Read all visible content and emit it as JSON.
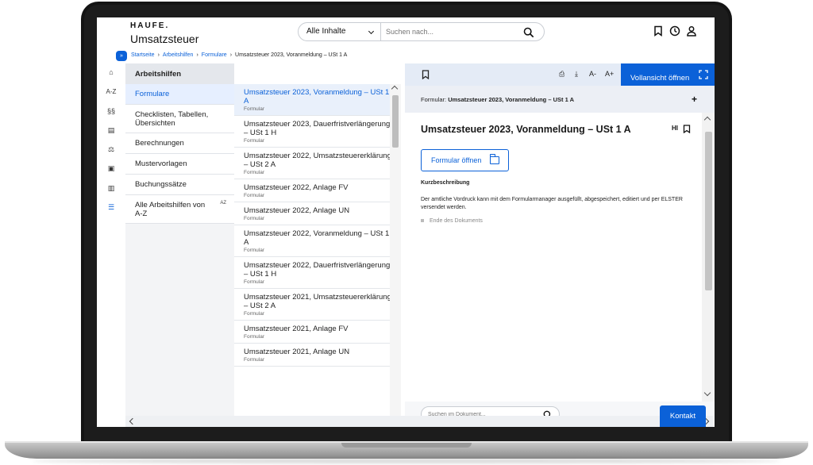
{
  "header": {
    "logo": "HAUFE.",
    "title": "Umsatzsteuer",
    "search_scope": "Alle Inhalte",
    "search_placeholder": "Suchen nach..."
  },
  "breadcrumb": {
    "toggle": "»",
    "items": [
      "Startseite",
      "Arbeitshilfen",
      "Formulare"
    ],
    "current": "Umsatzsteuer 2023, Voranmeldung – USt 1 A",
    "separator": "›"
  },
  "rail": {
    "items": [
      {
        "icon": "home-icon",
        "glyph": "⌂"
      },
      {
        "icon": "a-z-icon",
        "glyph": "A-Z"
      },
      {
        "icon": "paragraph-icon",
        "glyph": "§§"
      },
      {
        "icon": "document-icon",
        "glyph": "▤"
      },
      {
        "icon": "scales-icon",
        "glyph": "⚖"
      },
      {
        "icon": "video-icon",
        "glyph": "▣"
      },
      {
        "icon": "books-icon",
        "glyph": "▥"
      },
      {
        "icon": "list-icon",
        "glyph": "☰"
      }
    ]
  },
  "categories": {
    "heading": "Arbeitshilfen",
    "items": [
      {
        "label": "Formulare"
      },
      {
        "label": "Checklisten, Tabellen, Übersichten"
      },
      {
        "label": "Berechnungen"
      },
      {
        "label": "Mustervorlagen"
      },
      {
        "label": "Buchungssätze"
      },
      {
        "label": "Alle Arbeitshilfen von A-Z",
        "badge": "AZ"
      }
    ]
  },
  "documents": [
    {
      "title": "Umsatzsteuer 2023, Voranmeldung – USt 1 A",
      "type": "Formular"
    },
    {
      "title": "Umsatzsteuer 2023, Dauerfristverlängerung – USt 1 H",
      "type": "Formular"
    },
    {
      "title": "Umsatzsteuer 2022, Umsatzsteuererklärung – USt 2 A",
      "type": "Formular"
    },
    {
      "title": "Umsatzsteuer 2022, Anlage FV",
      "type": "Formular"
    },
    {
      "title": "Umsatzsteuer 2022, Anlage UN",
      "type": "Formular"
    },
    {
      "title": "Umsatzsteuer 2022, Voranmeldung – USt 1 A",
      "type": "Formular"
    },
    {
      "title": "Umsatzsteuer 2022, Dauerfristverlängerung – USt 1 H",
      "type": "Formular"
    },
    {
      "title": "Umsatzsteuer 2021, Umsatzsteuererklärung – USt 2 A",
      "type": "Formular"
    },
    {
      "title": "Umsatzsteuer 2021, Anlage FV",
      "type": "Formular"
    },
    {
      "title": "Umsatzsteuer 2021, Anlage UN",
      "type": "Formular"
    }
  ],
  "detail": {
    "toolbar": {
      "print": "⎙",
      "download": "⤓",
      "font_smaller": "A-",
      "font_larger": "A+",
      "full_view": "Vollansicht öffnen"
    },
    "sub_label": "Formular:",
    "sub_title": "Umsatzsteuer 2023, Voranmeldung – USt 1 A",
    "plus": "+",
    "title": "Umsatzsteuer 2023, Voranmeldung – USt 1 A",
    "hi": "HI",
    "open_form": "Formular öffnen",
    "section": "Kurzbeschreibung",
    "text": "Der amtliche Vordruck kann mit dem Formularmanager ausgefüllt, abgespeichert, editiert und per ELSTER versendet werden.",
    "end": "Ende des Dokuments",
    "search_placeholder": "Suchen im Dokument..."
  },
  "contact": "Kontakt",
  "colors": {
    "accent": "#0b61d8"
  }
}
